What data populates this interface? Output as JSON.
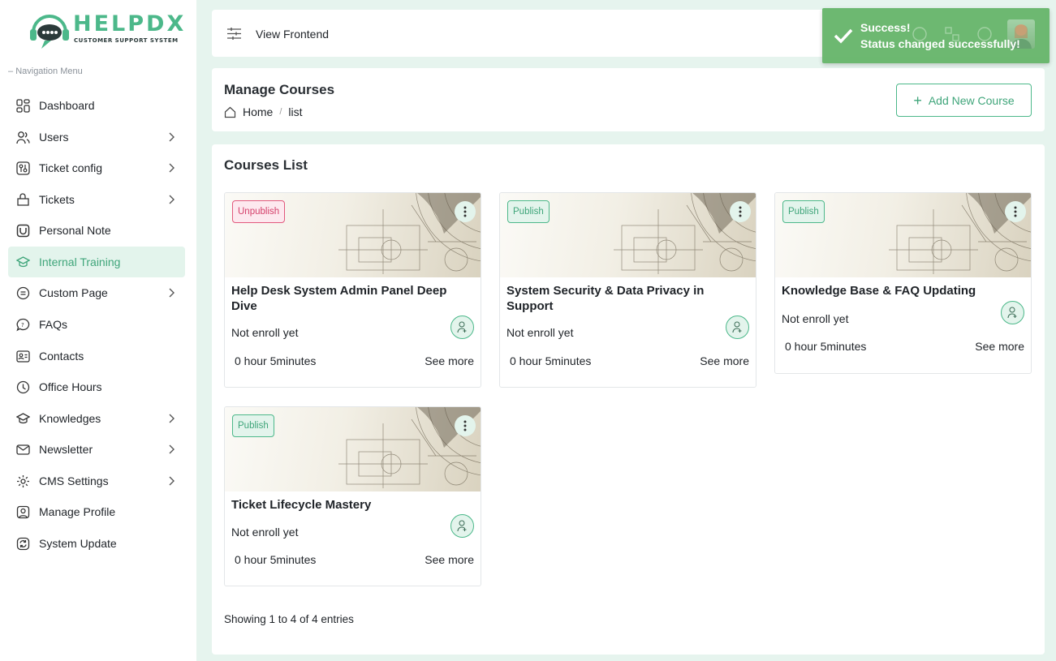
{
  "brand": {
    "name": "HELPDX",
    "tagline": "CUSTOMER SUPPORT SYSTEM"
  },
  "sidebar": {
    "header": "Navigation Menu",
    "items": [
      {
        "label": "Dashboard",
        "icon": "dashboard-icon",
        "has_submenu": false
      },
      {
        "label": "Users",
        "icon": "users-icon",
        "has_submenu": true
      },
      {
        "label": "Ticket config",
        "icon": "ticket-config-icon",
        "has_submenu": true
      },
      {
        "label": "Tickets",
        "icon": "tickets-icon",
        "has_submenu": true
      },
      {
        "label": "Personal Note",
        "icon": "note-icon",
        "has_submenu": false
      },
      {
        "label": "Internal Training",
        "icon": "graduation-cap-icon",
        "has_submenu": false,
        "active": true
      },
      {
        "label": "Custom Page",
        "icon": "page-icon",
        "has_submenu": true
      },
      {
        "label": "FAQs",
        "icon": "faq-icon",
        "has_submenu": false
      },
      {
        "label": "Contacts",
        "icon": "contacts-icon",
        "has_submenu": false
      },
      {
        "label": "Office Hours",
        "icon": "clock-icon",
        "has_submenu": false
      },
      {
        "label": "Knowledges",
        "icon": "knowledge-icon",
        "has_submenu": true
      },
      {
        "label": "Newsletter",
        "icon": "newsletter-icon",
        "has_submenu": true
      },
      {
        "label": "CMS Settings",
        "icon": "gear-icon",
        "has_submenu": true
      },
      {
        "label": "Manage Profile",
        "icon": "profile-icon",
        "has_submenu": false
      },
      {
        "label": "System Update",
        "icon": "update-icon",
        "has_submenu": false
      }
    ]
  },
  "topbar": {
    "view_frontend": "View Frontend"
  },
  "page": {
    "title": "Manage Courses",
    "breadcrumb": {
      "home": "Home",
      "current": "list"
    },
    "add_button": "Add New Course"
  },
  "courses_list": {
    "title": "Courses List",
    "courses": [
      {
        "status": "Unpublish",
        "title": "Help Desk System Admin Panel Deep Dive",
        "enroll": "Not enroll yet",
        "duration": "0 hour 5minutes",
        "see_more": "See more"
      },
      {
        "status": "Publish",
        "title": "System Security & Data Privacy in Support",
        "enroll": "Not enroll yet",
        "duration": "0 hour 5minutes",
        "see_more": "See more"
      },
      {
        "status": "Publish",
        "title": "Knowledge Base & FAQ Updating",
        "enroll": "Not enroll yet",
        "duration": "0 hour 5minutes",
        "see_more": "See more"
      },
      {
        "status": "Publish",
        "title": "Ticket Lifecycle Mastery",
        "enroll": "Not enroll yet",
        "duration": "0 hour 5minutes",
        "see_more": "See more"
      }
    ],
    "showing": "Showing 1 to 4 of 4 entries"
  },
  "toast": {
    "title": "Success!",
    "message": "Status changed successfully!"
  },
  "colors": {
    "accent": "#4cb88a",
    "active_bg": "#e3f4ec",
    "unpublish": "#e2597d",
    "toast": "#66b56a",
    "page_bg": "#e6f4ee"
  }
}
